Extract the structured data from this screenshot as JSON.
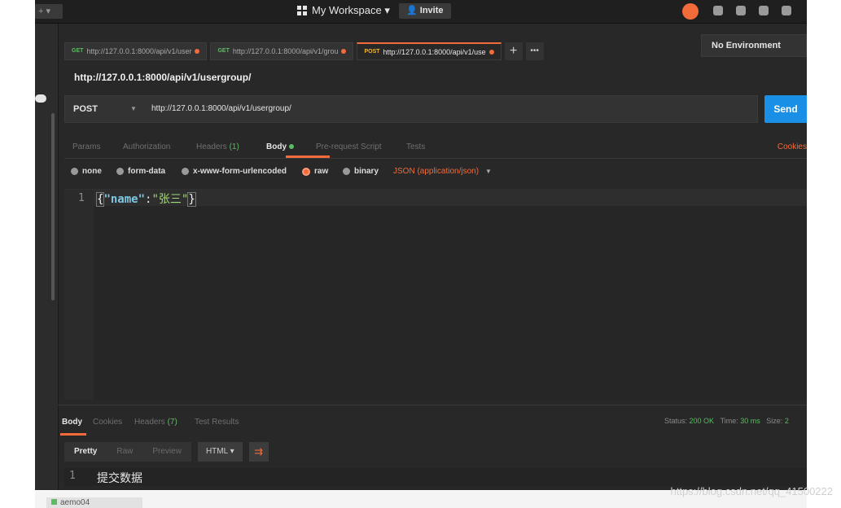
{
  "topbar": {
    "left_stub": "+ ▾",
    "workspace_label": "My Workspace ▾",
    "invite_label": "Invite"
  },
  "tabs": [
    {
      "method": "GET",
      "url": "http://127.0.0.1:8000/api/v1/user"
    },
    {
      "method": "GET",
      "url": "http://127.0.0.1:8000/api/v1/grou"
    },
    {
      "method": "POST",
      "url": "http://127.0.0.1:8000/api/v1/use"
    }
  ],
  "tab_add": "+",
  "tab_more": "•••",
  "environment": "No Environment",
  "request_title": "http://127.0.0.1:8000/api/v1/usergroup/",
  "urlbar": {
    "method": "POST",
    "url": "http://127.0.0.1:8000/api/v1/usergroup/",
    "send_label": "Send"
  },
  "subtabs": {
    "params": "Params",
    "authorization": "Authorization",
    "headers": "Headers",
    "headers_count": "(1)",
    "body": "Body",
    "prerequest": "Pre-request Script",
    "tests": "Tests",
    "cookies": "Cookies"
  },
  "body_modes": {
    "none": "none",
    "form_data": "form-data",
    "urlencoded": "x-www-form-urlencoded",
    "raw": "raw",
    "binary": "binary",
    "content_type": "JSON (application/json)"
  },
  "editor": {
    "line_number": "1",
    "open": "{",
    "key": "\"name\"",
    "colon": ":",
    "value": "\"张三\"",
    "close": "}"
  },
  "response": {
    "tab_body": "Body",
    "tab_cookies": "Cookies",
    "tab_headers": "Headers",
    "tab_headers_count": "(7)",
    "tab_tests": "Test Results",
    "status_label": "Status:",
    "status_value": "200 OK",
    "time_label": "Time:",
    "time_value": "30 ms",
    "size_label": "Size:",
    "size_value": "2",
    "pretty": "Pretty",
    "raw": "Raw",
    "preview": "Preview",
    "format": "HTML ▾",
    "line_number": "1",
    "content": "提交数据"
  },
  "watermark": "https://blog.csdn.net/qq_41500222",
  "below_chip": "aemo04"
}
